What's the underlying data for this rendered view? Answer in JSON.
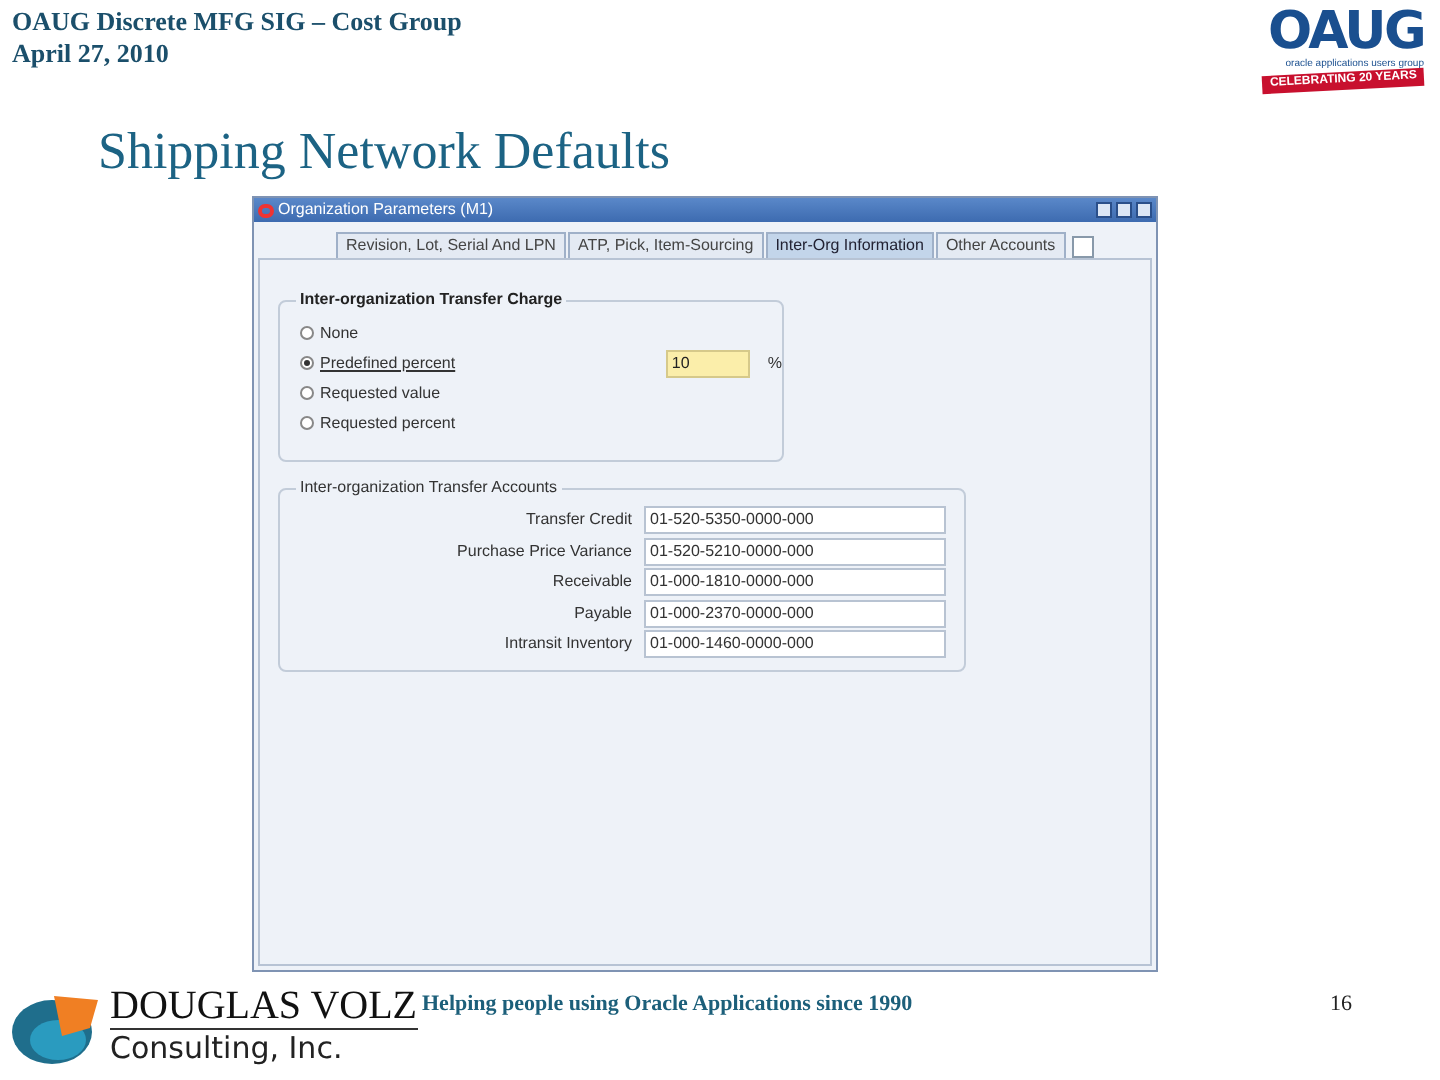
{
  "header": {
    "line_1": "OAUG Discrete MFG SIG – Cost Group",
    "line_2": "April 27, 2010"
  },
  "oaug_logo": {
    "wordmark": "OAUG",
    "tagline": "oracle applications users group",
    "ribbon": "CELEBRATING 20 YEARS"
  },
  "slide_title": "Shipping Network Defaults",
  "window": {
    "title": "Organization Parameters (M1)",
    "tabs": [
      {
        "label": "Revision, Lot, Serial And LPN",
        "selected": false
      },
      {
        "label": "ATP, Pick, Item-Sourcing",
        "selected": false
      },
      {
        "label": "Inter-Org Information",
        "selected": true
      },
      {
        "label": "Other Accounts",
        "selected": false
      }
    ],
    "transfer_charge": {
      "title": "Inter-organization Transfer Charge",
      "options": [
        {
          "label": "None",
          "selected": false
        },
        {
          "label": "Predefined percent",
          "selected": true
        },
        {
          "label": "Requested value",
          "selected": false
        },
        {
          "label": "Requested percent",
          "selected": false
        }
      ],
      "percent_value": "10",
      "percent_sign": "%"
    },
    "accounts": {
      "title": "Inter-organization Transfer Accounts",
      "rows": [
        {
          "label": "Transfer Credit",
          "value": "01-520-5350-0000-000"
        },
        {
          "label": "Purchase Price Variance",
          "value": "01-520-5210-0000-000"
        },
        {
          "label": "Receivable",
          "value": "01-000-1810-0000-000"
        },
        {
          "label": "Payable",
          "value": "01-000-2370-0000-000"
        },
        {
          "label": "Intransit Inventory",
          "value": "01-000-1460-0000-000"
        }
      ]
    }
  },
  "footer": {
    "company_name": "DOUGLAS VOLZ",
    "company_suffix": "Consulting, Inc.",
    "tagline": "Helping people using Oracle Applications since 1990",
    "page_number": "16"
  }
}
